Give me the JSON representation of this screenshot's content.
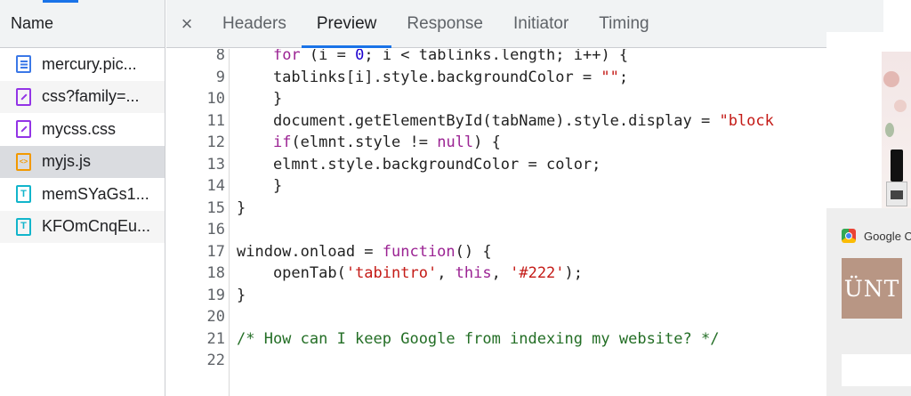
{
  "file_list": {
    "header": "Name",
    "items": [
      {
        "name": "mercury.pic...",
        "type": "document"
      },
      {
        "name": "css?family=...",
        "type": "stylesheet"
      },
      {
        "name": "mycss.css",
        "type": "stylesheet"
      },
      {
        "name": "myjs.js",
        "type": "script",
        "selected": true
      },
      {
        "name": "memSYaGs1...",
        "type": "font"
      },
      {
        "name": "KFOmCnqEu...",
        "type": "font"
      }
    ],
    "icon_glyphs": {
      "script": "<>",
      "font": "T"
    }
  },
  "tabs": {
    "close_glyph": "×",
    "items": [
      {
        "label": "Headers"
      },
      {
        "label": "Preview",
        "active": true
      },
      {
        "label": "Response"
      },
      {
        "label": "Initiator"
      },
      {
        "label": "Timing"
      }
    ]
  },
  "code": {
    "lines": [
      {
        "n": "8",
        "tokens": [
          {
            "t": "    "
          },
          {
            "t": "for",
            "c": "kw"
          },
          {
            "t": " (i = "
          },
          {
            "t": "0",
            "c": "num"
          },
          {
            "t": "; i < tablinks.length; i++) {"
          }
        ]
      },
      {
        "n": "9",
        "tokens": [
          {
            "t": "    tablinks[i].style.backgroundColor = "
          },
          {
            "t": "\"\"",
            "c": "str"
          },
          {
            "t": ";"
          }
        ]
      },
      {
        "n": "10",
        "tokens": [
          {
            "t": "    }"
          }
        ]
      },
      {
        "n": "11",
        "tokens": [
          {
            "t": "    document.getElementById(tabName).style.display = "
          },
          {
            "t": "\"block",
            "c": "str"
          }
        ]
      },
      {
        "n": "12",
        "tokens": [
          {
            "t": "    "
          },
          {
            "t": "if",
            "c": "kw"
          },
          {
            "t": "(elmnt.style != "
          },
          {
            "t": "null",
            "c": "kw"
          },
          {
            "t": ") {"
          }
        ]
      },
      {
        "n": "13",
        "tokens": [
          {
            "t": "    elmnt.style.backgroundColor = color;"
          }
        ]
      },
      {
        "n": "14",
        "tokens": [
          {
            "t": "    }"
          }
        ]
      },
      {
        "n": "15",
        "tokens": [
          {
            "t": "}"
          }
        ]
      },
      {
        "n": "16",
        "tokens": []
      },
      {
        "n": "17",
        "tokens": [
          {
            "t": "window.onload = "
          },
          {
            "t": "function",
            "c": "kw"
          },
          {
            "t": "() {"
          }
        ]
      },
      {
        "n": "18",
        "tokens": [
          {
            "t": "    openTab("
          },
          {
            "t": "'tabintro'",
            "c": "str"
          },
          {
            "t": ", "
          },
          {
            "t": "this",
            "c": "kw"
          },
          {
            "t": ", "
          },
          {
            "t": "'#222'",
            "c": "str"
          },
          {
            "t": ");"
          }
        ]
      },
      {
        "n": "19",
        "tokens": [
          {
            "t": "}"
          }
        ]
      },
      {
        "n": "20",
        "tokens": []
      },
      {
        "n": "21",
        "tokens": [
          {
            "t": "/* How can I keep Google from indexing my website? */",
            "c": "cmt"
          }
        ]
      },
      {
        "n": "22",
        "tokens": []
      }
    ]
  },
  "page_preview": {
    "google_label": "Google C",
    "logo_text": "ÜNT"
  },
  "colors": {
    "accent": "#1a73e8",
    "keyword": "#9b2393",
    "string": "#c41a16",
    "number": "#1c00cf",
    "comment": "#236e25",
    "annotation": "#e3120b"
  }
}
